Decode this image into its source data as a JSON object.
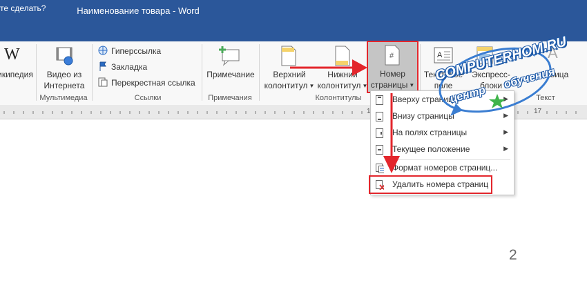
{
  "window": {
    "title": "Наименование товара - Word"
  },
  "tellme": {
    "text": "те сделать?"
  },
  "ribbon": {
    "wiki_label": "икипедия",
    "video_label": [
      "Видео из",
      "Интернета"
    ],
    "links_items": [
      "Гиперссылка",
      "Закладка",
      "Перекрестная ссылка"
    ],
    "comment_label": "Примечание",
    "header_label": [
      "Верхний",
      "колонтитул"
    ],
    "footer_label": [
      "Нижний",
      "колонтитул"
    ],
    "page_number_label": [
      "Номер",
      "страницы"
    ],
    "textbox_label": [
      "Текстовое",
      "поле"
    ],
    "express_label": [
      "Экспресс-",
      "блоки"
    ],
    "wordart_label": "вица",
    "groups": {
      "media": "Мультимедиа",
      "links": "Ссылки",
      "comments": "Примечания",
      "header_footer": "Колонтитулы",
      "text": "Текст"
    }
  },
  "menu": {
    "items": [
      {
        "label": "Вверху страницы",
        "submenu": true
      },
      {
        "label": "Внизу страницы",
        "submenu": true
      },
      {
        "label": "На полях страницы",
        "submenu": true
      },
      {
        "label": "Текущее положение",
        "submenu": true
      },
      {
        "label": "Формат номеров страниц...",
        "submenu": false
      },
      {
        "label": "Удалить номера страниц",
        "submenu": false
      }
    ]
  },
  "ruler": {
    "marks": [
      "1",
      "17"
    ]
  },
  "document": {
    "page_number": "2"
  },
  "watermark": {
    "line1": "COMPUTERHOM.RU",
    "line2": "центр обучения"
  },
  "colors": {
    "title_bar": "#2b579a",
    "highlight": "#e3262c",
    "ribbon_bg": "#f8f8f8",
    "button_pressed": "#c5c5c5"
  }
}
